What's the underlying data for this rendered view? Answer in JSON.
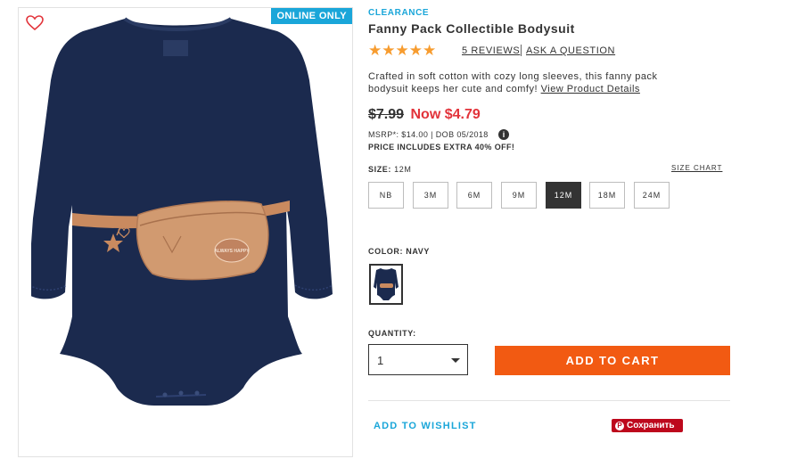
{
  "image_panel": {
    "badge": "ONLINE ONLY",
    "icon": "heart-outline-icon",
    "print_text": "ALWAYS HAPPY"
  },
  "product": {
    "tag": "CLEARANCE",
    "title": "Fanny Pack Collectible Bodysuit",
    "rating": 5,
    "stars": "★★★★★",
    "reviews": "5 REVIEWS",
    "ask": "ASK A QUESTION",
    "description": "Crafted in soft cotton with cozy long sleeves, this fanny pack bodysuit keeps her cute and comfy!",
    "details_link": "View Product Details"
  },
  "price": {
    "old": "$7.99",
    "now": "Now $4.79",
    "msrp": "MSRP*: $14.00 | DOB 05/2018",
    "info_icon": "i",
    "extra": "PRICE INCLUDES EXTRA 40% OFF!"
  },
  "size": {
    "label": "SIZE:",
    "selected": "12M",
    "chart": "SIZE CHART",
    "options": [
      "NB",
      "3M",
      "6M",
      "9M",
      "12M",
      "18M",
      "24M"
    ]
  },
  "color": {
    "label": "COLOR:",
    "selected": "NAVY"
  },
  "quantity": {
    "label": "QUANTITY:",
    "value": "1"
  },
  "actions": {
    "add_to_cart": "ADD TO CART",
    "wishlist": "ADD TO WISHLIST",
    "pinterest": "Сохранить"
  },
  "colors": {
    "accent_blue": "#1aa6d9",
    "cta_orange": "#f25a12",
    "sale_red": "#e2333a",
    "star_orange": "#f79c2f",
    "navy": "#1b2a4e",
    "pinterest_red": "#bd081c"
  }
}
